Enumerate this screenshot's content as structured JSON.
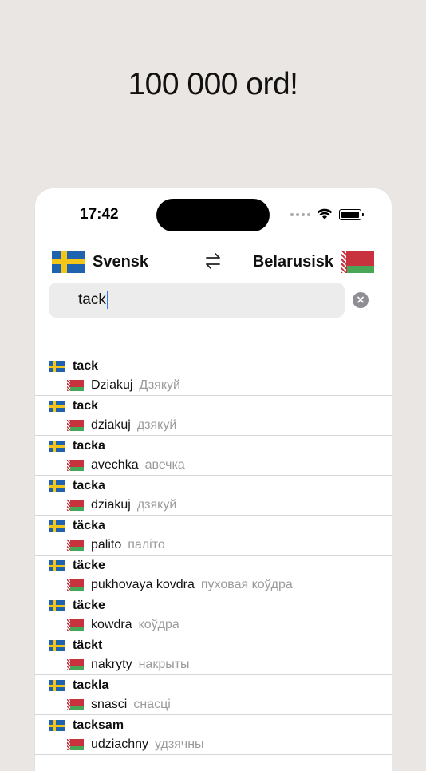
{
  "headline": "100 000 ord!",
  "status": {
    "time": "17:42"
  },
  "languages": {
    "source": "Svensk",
    "target": "Belarusisk"
  },
  "search": {
    "value": "tack"
  },
  "icons": {
    "swap": "swap-arrows-icon",
    "clear": "clear-circle-icon",
    "wifi": "wifi-icon",
    "battery": "battery-icon",
    "source_flag": "sweden-flag-icon",
    "target_flag": "belarus-flag-icon"
  },
  "colors": {
    "accent": "#2f7cf6",
    "muted": "#9b9b9b",
    "background": "#e9e6e3"
  },
  "results": [
    {
      "word": "tack",
      "latin": "Dziakuj",
      "cyrillic": "Дзякуй"
    },
    {
      "word": "tack",
      "latin": "dziakuj",
      "cyrillic": "дзякуй"
    },
    {
      "word": "tacka",
      "latin": "avechka",
      "cyrillic": "авечка"
    },
    {
      "word": "tacka",
      "latin": "dziakuj",
      "cyrillic": "дзякуй"
    },
    {
      "word": "täcka",
      "latin": "palito",
      "cyrillic": "паліто"
    },
    {
      "word": "täcke",
      "latin": "pukhovaya kovdra",
      "cyrillic": "пуховая коўдра"
    },
    {
      "word": "täcke",
      "latin": "kowdra",
      "cyrillic": "коўдра"
    },
    {
      "word": "täckt",
      "latin": "nakryty",
      "cyrillic": "накрыты"
    },
    {
      "word": "tackla",
      "latin": "snasci",
      "cyrillic": "снасці"
    },
    {
      "word": "tacksam",
      "latin": "udziachny",
      "cyrillic": "удзячны"
    }
  ]
}
